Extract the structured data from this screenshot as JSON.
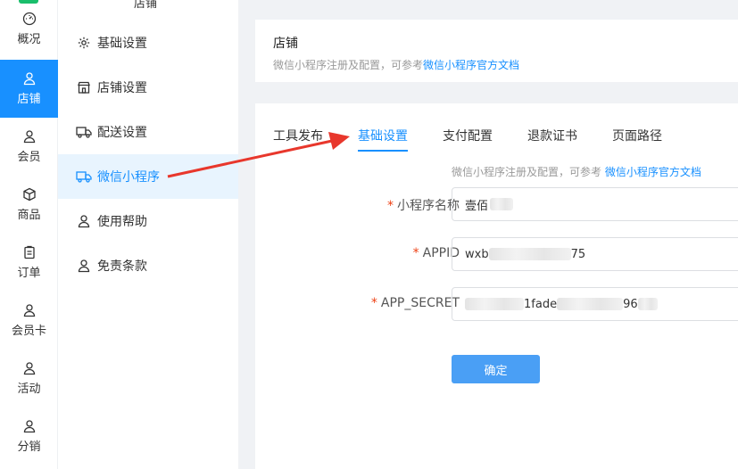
{
  "rail": {
    "items": [
      {
        "label": "概况",
        "icon": "dashboard-icon"
      },
      {
        "label": "店铺",
        "icon": "user-icon",
        "active": true
      },
      {
        "label": "会员",
        "icon": "user-icon"
      },
      {
        "label": "商品",
        "icon": "cube-icon"
      },
      {
        "label": "订单",
        "icon": "clipboard-icon"
      },
      {
        "label": "会员卡",
        "icon": "user-icon"
      },
      {
        "label": "活动",
        "icon": "user-icon"
      },
      {
        "label": "分销",
        "icon": "user-icon"
      }
    ]
  },
  "submenu": {
    "title": "店铺",
    "items": [
      {
        "label": "基础设置",
        "icon": "gear-icon"
      },
      {
        "label": "店铺设置",
        "icon": "store-icon"
      },
      {
        "label": "配送设置",
        "icon": "truck-icon"
      },
      {
        "label": "微信小程序",
        "icon": "truck-icon",
        "active": true
      },
      {
        "label": "使用帮助",
        "icon": "user-icon"
      },
      {
        "label": "免责条款",
        "icon": "user-icon"
      }
    ]
  },
  "header": {
    "title": "店铺",
    "desc_prefix": "微信小程序注册及配置，可参考",
    "desc_link": "微信小程序官方文档"
  },
  "tabs": [
    {
      "label": "工具发布"
    },
    {
      "label": "基础设置",
      "active": true
    },
    {
      "label": "支付配置"
    },
    {
      "label": "退款证书"
    },
    {
      "label": "页面路径"
    }
  ],
  "hint": {
    "prefix": "微信小程序注册及配置，可参考",
    "link": "微信小程序官方文档"
  },
  "form": {
    "name_label": "小程序名称",
    "name_value": "壹佰",
    "appid_label": "APPID",
    "appid_prefix": "wxb",
    "appid_suffix": "75",
    "secret_label": "APP_SECRET",
    "secret_part1": "1fade",
    "secret_part2": "96",
    "required_mark": "*",
    "submit_label": "确定"
  },
  "colors": {
    "accent": "#1890ff",
    "button": "#4a9ff5",
    "required": "#ed4014",
    "annotation_arrow": "#e8372c"
  }
}
